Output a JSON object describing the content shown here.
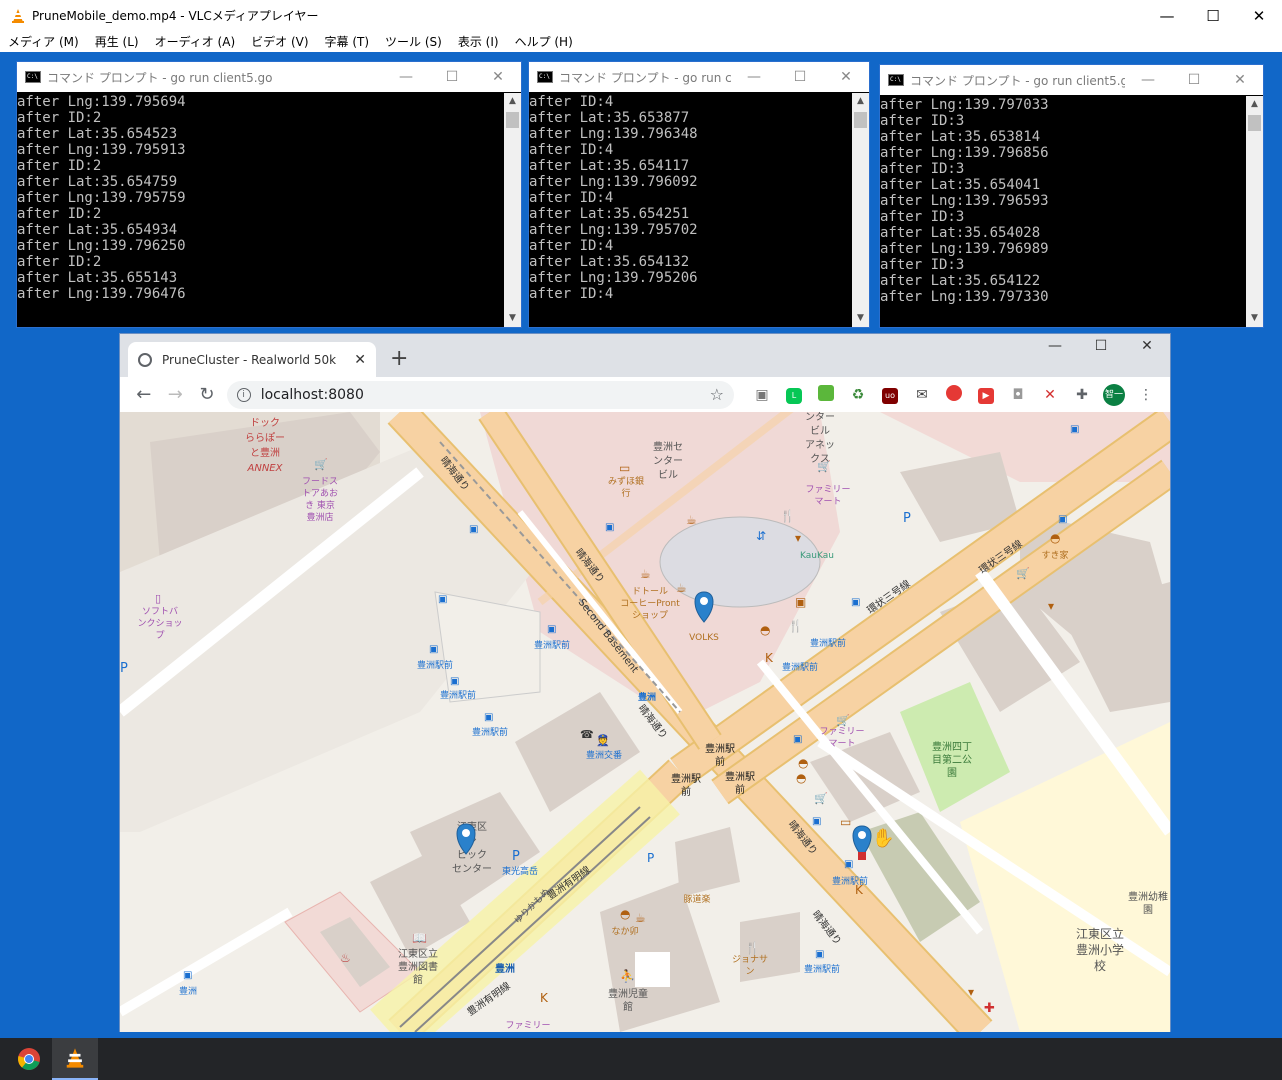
{
  "vlc": {
    "title": "PruneMobile_demo.mp4 - VLCメディアプレイヤー",
    "menu": [
      "メディア (M)",
      "再生 (L)",
      "オーディオ (A)",
      "ビデオ (V)",
      "字幕 (T)",
      "ツール (S)",
      "表示 (I)",
      "ヘルプ (H)"
    ]
  },
  "consoles": [
    {
      "title": "コマンド プロンプト - go  run client5.go",
      "lines": "after Lng:139.795694\nafter ID:2\nafter Lat:35.654523\nafter Lng:139.795913\nafter ID:2\nafter Lat:35.654759\nafter Lng:139.795759\nafter ID:2\nafter Lat:35.654934\nafter Lng:139.796250\nafter ID:2\nafter Lat:35.655143\nafter Lng:139.796476"
    },
    {
      "title": "コマンド プロンプト - go  run client...",
      "lines": "after ID:4\nafter Lat:35.653877\nafter Lng:139.796348\nafter ID:4\nafter Lat:35.654117\nafter Lng:139.796092\nafter ID:4\nafter Lat:35.654251\nafter Lng:139.795702\nafter ID:4\nafter Lat:35.654132\nafter Lng:139.795206\nafter ID:4"
    },
    {
      "title": "コマンド プロンプト - go  run client5.go",
      "lines": "after Lng:139.797033\nafter ID:3\nafter Lat:35.653814\nafter Lng:139.796856\nafter ID:3\nafter Lat:35.654041\nafter Lng:139.796593\nafter ID:3\nafter Lat:35.654028\nafter Lng:139.796989\nafter ID:3\nafter Lat:35.654122\nafter Lng:139.797330"
    }
  ],
  "browser": {
    "tab_title": "PruneCluster - Realworld 50k",
    "url": "localhost:8080",
    "avatar": "智一"
  },
  "map": {
    "labels": {
      "lalaport": "ドック\nららぽー\nと豊洲\nANNEX",
      "foods": "フードス\nトアあお\nき 東京\n豊洲店",
      "softbank": "ソフトバ\nンクショッ\nプ",
      "center": "豊洲セ\nンター\nビル",
      "mizuho": "みずほ銀\n行",
      "tower": "ンター\nビル\nアネッ\nクス",
      "familymart1": "ファミリー\nマート",
      "kaukau": "KauKau",
      "doutor": "ドトール\nコーヒーPront\nショップ",
      "volks": "VOLKS",
      "second_basement": "Second Basement",
      "harumi1": "晴海通り",
      "harumi2": "晴海通り",
      "harumi3": "晴海通り",
      "harumi4": "晴海通り",
      "harumi5": "晴海通り",
      "kanjo1": "環状三号線",
      "kanjo2": "環状三号線",
      "sukiya": "すき家",
      "toyosu_eki_mae1": "豊洲駅前",
      "toyosu_eki_mae2": "豊洲駅前",
      "toyosu_eki_mae3": "豊洲駅前",
      "toyosu_eki_mae4": "豊洲駅前",
      "toyosu_eki_mae5": "豊洲駅前",
      "toyosu_eki_mae6": "豊洲駅前",
      "toyosu_eki_mae7": "豊洲駅前",
      "toyosu_eki_mae8": "豊洲駅前",
      "eki_mae_a": "豊洲駅\n前",
      "eki_mae_b": "豊洲駅\n前",
      "eki_mae_c": "豊洲駅\n前",
      "koban": "豊洲交番",
      "familymart2": "ファミリー\nマート",
      "park": "豊洲四丁\n目第二公\n園",
      "civic": "江東区\nシ\nビック\nセンター",
      "toko": "東光高岳",
      "toyosu_station": "豊洲",
      "yurikamome": "ゆりかもめ",
      "ariake1": "豊洲有明線",
      "ariake2": "豊洲有明線",
      "library": "江東区立\n豊洲図書\n館",
      "kihei": "豚道楽",
      "nakau": "なか卯",
      "jonathan": "ジョナサ\nン",
      "jidokan": "豊洲児童\n館",
      "kindergarten": "豊洲幼稚\n園",
      "school": "江東区立\n豊洲小学\n校",
      "toyosu_bottom": "豊洲",
      "familymart3": "ファミリー",
      "toyosu_bld": "豊洲"
    }
  }
}
